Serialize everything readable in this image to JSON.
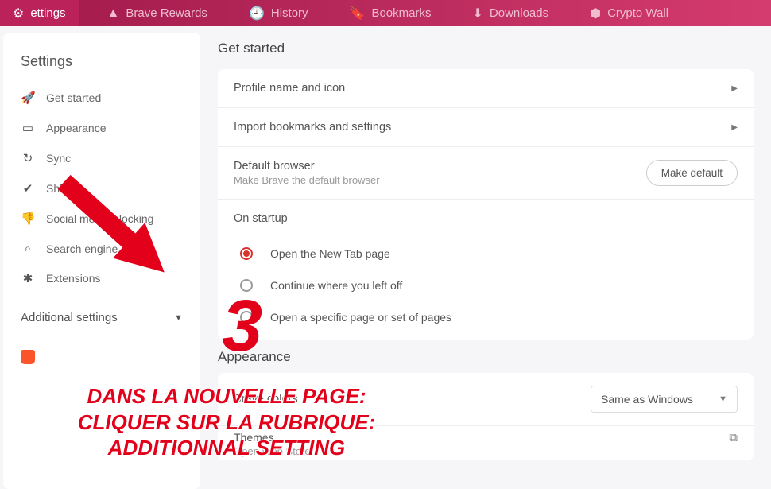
{
  "topbar": [
    {
      "icon": "⚙",
      "label": "ettings",
      "active": true
    },
    {
      "icon": "▲",
      "label": "Brave Rewards",
      "active": false
    },
    {
      "icon": "🕘",
      "label": "History",
      "active": false
    },
    {
      "icon": "🔖",
      "label": "Bookmarks",
      "active": false
    },
    {
      "icon": "⬇",
      "label": "Downloads",
      "active": false
    },
    {
      "icon": "⬢",
      "label": "Crypto Wall",
      "active": false
    }
  ],
  "sidebar": {
    "title": "Settings",
    "items": [
      {
        "icon": "🚀",
        "label": "Get started",
        "name": "get-started"
      },
      {
        "icon": "▭",
        "label": "Appearance",
        "name": "appearance"
      },
      {
        "icon": "↻",
        "label": "Sync",
        "name": "sync"
      },
      {
        "icon": "✔",
        "label": "Shields",
        "name": "shields"
      },
      {
        "icon": "👎",
        "label": "Social media blocking",
        "name": "social-blocking"
      },
      {
        "icon": "⌕",
        "label": "Search engine",
        "name": "search-engine"
      },
      {
        "icon": "✱",
        "label": "Extensions",
        "name": "extensions"
      }
    ],
    "additional": "Additional settings"
  },
  "main": {
    "section1_title": "Get started",
    "profile_row": "Profile name and icon",
    "import_row": "Import bookmarks and settings",
    "default_title": "Default browser",
    "default_sub": "Make Brave the default browser",
    "default_btn": "Make default",
    "startup_title": "On startup",
    "startup_options": [
      {
        "label": "Open the New Tab page",
        "selected": true
      },
      {
        "label": "Continue where you left off",
        "selected": false
      },
      {
        "label": "Open a specific page or set of pages",
        "selected": false
      }
    ],
    "section2_title": "Appearance",
    "brave_colors_row": "Brave colors",
    "color_select": "Same as Windows",
    "themes_row": "Themes",
    "themes_sub": "Open Web Store"
  },
  "annotation": {
    "number": "3",
    "line1": "DANS LA NOUVELLE PAGE:",
    "line2": "CLIQUER SUR LA RUBRIQUE:",
    "line3": "ADDITIONNAL SETTING"
  }
}
